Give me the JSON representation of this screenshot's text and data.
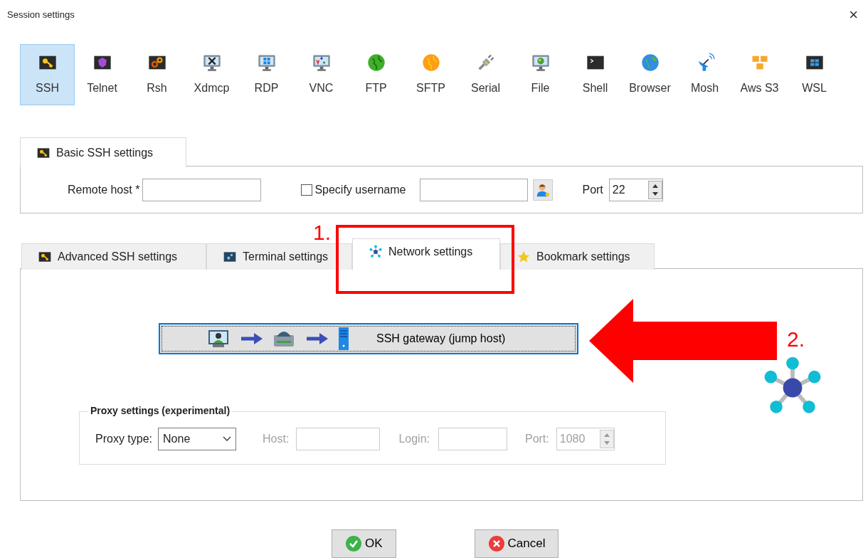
{
  "window": {
    "title": "Session settings",
    "close": "×"
  },
  "session_types": [
    {
      "label": "SSH",
      "kind": "ssh",
      "selected": true
    },
    {
      "label": "Telnet",
      "kind": "telnet",
      "selected": false
    },
    {
      "label": "Rsh",
      "kind": "rsh",
      "selected": false
    },
    {
      "label": "Xdmcp",
      "kind": "xdmcp",
      "selected": false
    },
    {
      "label": "RDP",
      "kind": "rdp",
      "selected": false
    },
    {
      "label": "VNC",
      "kind": "vnc",
      "selected": false
    },
    {
      "label": "FTP",
      "kind": "ftp",
      "selected": false
    },
    {
      "label": "SFTP",
      "kind": "sftp",
      "selected": false
    },
    {
      "label": "Serial",
      "kind": "serial",
      "selected": false
    },
    {
      "label": "File",
      "kind": "file",
      "selected": false
    },
    {
      "label": "Shell",
      "kind": "shell",
      "selected": false
    },
    {
      "label": "Browser",
      "kind": "browser",
      "selected": false
    },
    {
      "label": "Mosh",
      "kind": "mosh",
      "selected": false
    },
    {
      "label": "Aws S3",
      "kind": "s3",
      "selected": false
    },
    {
      "label": "WSL",
      "kind": "wsl",
      "selected": false
    }
  ],
  "basic_tab": {
    "label": "Basic SSH settings"
  },
  "basic": {
    "remote_host_label": "Remote host *",
    "specify_username": {
      "label": "Specify username",
      "checked": false
    },
    "port_label": "Port",
    "port": "22"
  },
  "tabs": [
    {
      "label": "Advanced SSH settings",
      "kind": "ssh",
      "selected": false
    },
    {
      "label": "Terminal settings",
      "kind": "terminal",
      "selected": false
    },
    {
      "label": "Network settings",
      "kind": "network",
      "selected": true
    },
    {
      "label": "Bookmark settings",
      "kind": "star",
      "selected": false
    }
  ],
  "gateway_button": {
    "label": "SSH gateway (jump host)"
  },
  "proxy": {
    "legend": "Proxy settings (experimental)",
    "type_label": "Proxy type:",
    "type": "None",
    "host_label": "Host:",
    "login_label": "Login:",
    "port_label": "Port:",
    "port": "1080",
    "disabled": true
  },
  "buttons": [
    {
      "label": "OK",
      "kind": "ok"
    },
    {
      "label": "Cancel",
      "kind": "cancel"
    }
  ],
  "annotations": [
    {
      "label": "1."
    },
    {
      "label": "2."
    }
  ]
}
